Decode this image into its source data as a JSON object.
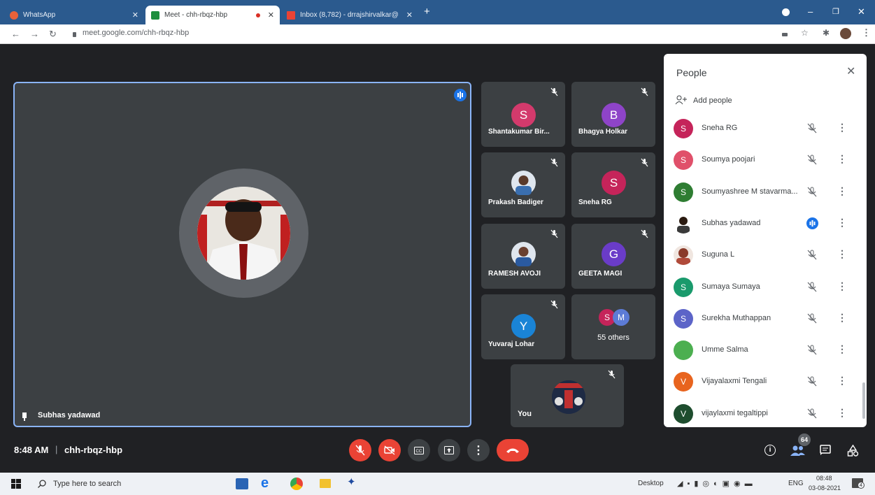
{
  "browser": {
    "tabs": [
      {
        "title": "WhatsApp",
        "color": "#e8623a"
      },
      {
        "title": "Meet - chh-rbqz-hbp",
        "color": "#1e8e3e"
      },
      {
        "title": "Inbox (8,782) - drrajshirvalkar@",
        "color": "#ea4335"
      }
    ],
    "url": "meet.google.com/chh-rbqz-hbp"
  },
  "speaker": {
    "name": "Subhas yadawad"
  },
  "tiles": [
    {
      "name": "Shantakumar Bir...",
      "initial": "S",
      "color": "#d33a6c"
    },
    {
      "name": "Bhagya Holkar",
      "initial": "B",
      "color": "#8e44c8"
    },
    {
      "name": "Prakash Badiger",
      "initial": "",
      "color": "#4a7ab8"
    },
    {
      "name": "Sneha RG",
      "initial": "S",
      "color": "#c5245a"
    },
    {
      "name": "RAMESH AVOJI",
      "initial": "",
      "color": "#3a6fb0"
    },
    {
      "name": "GEETA MAGI",
      "initial": "G",
      "color": "#6a3cc8"
    },
    {
      "name": "Yuvaraj Lohar",
      "initial": "Y",
      "color": "#1a84d6"
    },
    {
      "name": "55 others",
      "initial": "S",
      "initial2": "M",
      "color": "#c5245a",
      "color2": "#5c7bd6"
    },
    {
      "name": "You",
      "initial": "",
      "color": "#222222"
    }
  ],
  "people": {
    "title": "People",
    "add_label": "Add people",
    "rows": [
      {
        "name": "Sneha RG",
        "initial": "S",
        "color": "#c5245a",
        "speaking": false
      },
      {
        "name": "Soumya poojari",
        "initial": "S",
        "color": "#e0506a",
        "speaking": false
      },
      {
        "name": "Soumyashree M stavarma...",
        "initial": "S",
        "color": "#2e7d32",
        "speaking": false
      },
      {
        "name": "Subhas yadawad",
        "initial": "",
        "color": "#444444",
        "speaking": true
      },
      {
        "name": "Suguna L",
        "initial": "",
        "color": "#9e4a3a",
        "speaking": false
      },
      {
        "name": "Sumaya Sumaya",
        "initial": "S",
        "color": "#1a9a6c",
        "speaking": false
      },
      {
        "name": "Surekha Muthappan",
        "initial": "S",
        "color": "#5c64c8",
        "speaking": false
      },
      {
        "name": "Umme Salma",
        "initial": "",
        "color": "#4caf50",
        "speaking": false
      },
      {
        "name": "Vijayalaxmi Tengali",
        "initial": "V",
        "color": "#e8641e",
        "speaking": false
      },
      {
        "name": "vijaylaxmi tegaltippi",
        "initial": "V",
        "color": "#1e4d2e",
        "speaking": false
      }
    ]
  },
  "meeting": {
    "time": "8:48 AM",
    "separator": "|",
    "code": "chh-rbqz-hbp",
    "participant_count": "64"
  },
  "taskbar": {
    "search_placeholder": "Type here to search",
    "desktop_label": "Desktop",
    "lang": "ENG",
    "time": "08:48",
    "date": "03-08-2021",
    "notif_count": "4"
  }
}
